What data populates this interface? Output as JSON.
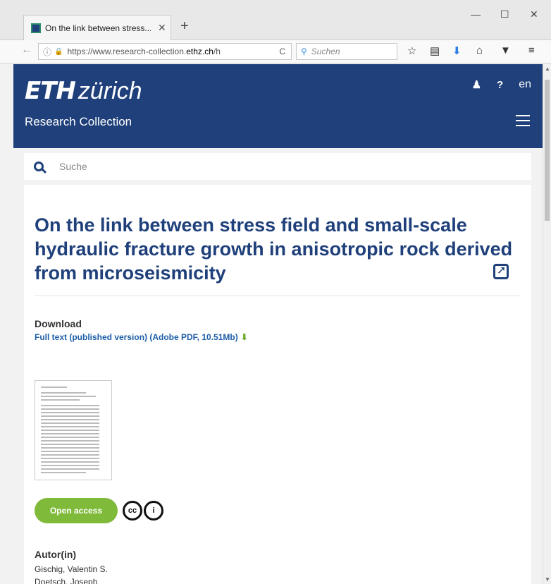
{
  "browser": {
    "tab_title": "On the link between stress...",
    "tab_close": "✕",
    "new_tab": "+",
    "minimize": "—",
    "maximize": "☐",
    "close": "✕",
    "back": "←",
    "info": "ⓘ",
    "lock": "🔒",
    "url_prefix": "https://www.research-collection.",
    "url_domain": "ethz.ch",
    "url_suffix": "/h",
    "reload": "C",
    "search_placeholder": "Suchen",
    "toolbar": [
      "☆",
      "▤",
      "⬇",
      "⌂",
      "▼",
      "≡"
    ]
  },
  "header": {
    "logo_eth": "ETH",
    "logo_zurich": "zürich",
    "subtitle": "Research Collection",
    "user_icon": "♟",
    "help": "?",
    "lang": "en"
  },
  "search": {
    "placeholder": "Suche"
  },
  "record": {
    "title": "On the link between stress field and small-scale hydraulic fracture growth in anisotropic rock derived from microseismicity",
    "download_label": "Download",
    "download_link": "Full text (published version) (Adobe PDF, 10.51Mb)",
    "download_arrow": "⬇",
    "open_access": "Open access",
    "cc_label": "cc",
    "by_label": "i",
    "author_label": "Autor(in)",
    "authors": [
      "Gischig, Valentin S.",
      "Doetsch, Joseph"
    ]
  }
}
